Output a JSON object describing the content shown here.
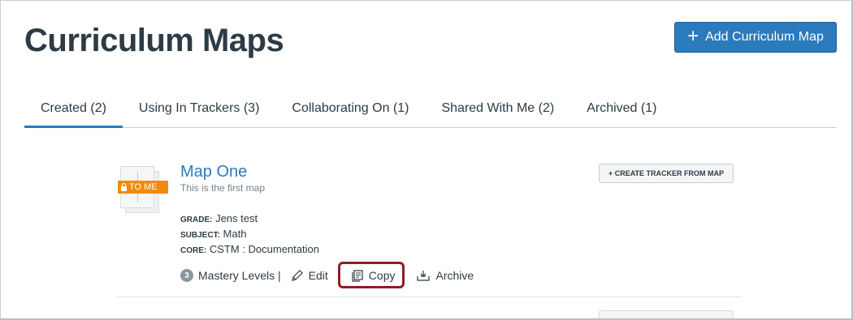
{
  "page": {
    "title": "Curriculum Maps",
    "add_button_label": "Add Curriculum Map"
  },
  "tabs": [
    {
      "label": "Created (2)",
      "active": true
    },
    {
      "label": "Using In Trackers (3)",
      "active": false
    },
    {
      "label": "Collaborating On (1)",
      "active": false
    },
    {
      "label": "Shared With Me (2)",
      "active": false
    },
    {
      "label": "Archived (1)",
      "active": false
    }
  ],
  "map_card": {
    "badge_label": "TO ME",
    "title": "Map One",
    "description": "This is the first map",
    "meta": [
      {
        "key": "GRADE:",
        "value": "Jens test"
      },
      {
        "key": "SUBJECT:",
        "value": "Math"
      },
      {
        "key": "CORE:",
        "value": "CSTM : Documentation"
      }
    ],
    "create_tracker_label": "+ CREATE TRACKER FROM MAP",
    "mastery_count": "3",
    "mastery_label": "Mastery Levels |",
    "edit_label": "Edit",
    "copy_label": "Copy",
    "archive_label": "Archive"
  },
  "colors": {
    "accent": "#2b7abc",
    "badge": "#f18b0b",
    "highlight": "#8e1e24"
  }
}
